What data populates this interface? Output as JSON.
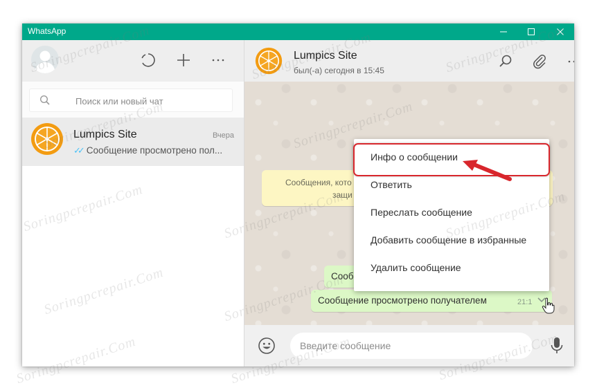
{
  "app": {
    "title": "WhatsApp"
  },
  "search": {
    "placeholder": "Поиск или новый чат"
  },
  "chat_list": [
    {
      "name": "Lumpics Site",
      "time": "Вчера",
      "last_message": "Сообщение просмотрено пол..."
    }
  ],
  "conversation": {
    "contact_name": "Lumpics Site",
    "status": "был(-а) сегодня в 15:45",
    "system_message_line1": "Сообщения, кото",
    "system_message_line2": "защи",
    "bubble_partial": "Сооб",
    "bubble_text": "Сообщение просмотрено получателем",
    "bubble_time": "21:1"
  },
  "composer": {
    "placeholder": "Введите сообщение"
  },
  "context_menu": {
    "items": [
      "Инфо о сообщении",
      "Ответить",
      "Переслать сообщение",
      "Добавить сообщение в избранные",
      "Удалить сообщение"
    ]
  },
  "watermark": {
    "text": "Soringpcrepair.Com"
  },
  "colors": {
    "titlebar": "#00a88a",
    "bubble": "#dcf8c6",
    "system_message": "#fdf6c3",
    "highlight": "#d8262c",
    "read_ticks": "#4fc3f7"
  },
  "icons": {
    "status": "status-icon",
    "new_chat": "plus-icon",
    "menu": "more-icon",
    "search": "search-icon",
    "attach": "paperclip-icon",
    "emoji": "emoji-icon",
    "mic": "microphone-icon"
  }
}
